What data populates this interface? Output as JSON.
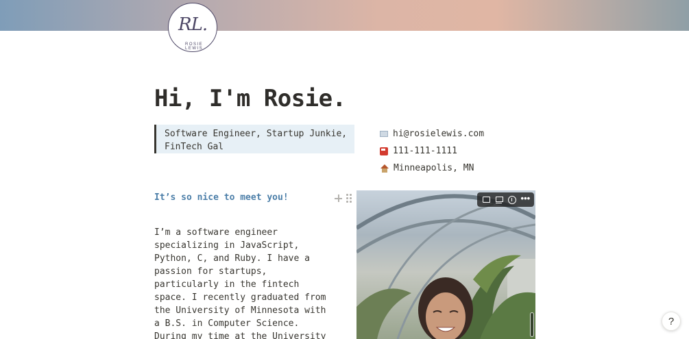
{
  "cover": {
    "gradient_colors": [
      "#7f9db8",
      "#dcb5a6",
      "#8f9fa6"
    ]
  },
  "logo": {
    "monogram": "RL.",
    "name": "ROSIE LEWIS"
  },
  "page": {
    "title": "Hi, I'm Rosie."
  },
  "quote": {
    "text": "Software Engineer, Startup Junkie, FinTech Gal"
  },
  "contact": [
    {
      "icon": "postbox-icon",
      "text": "hi@rosielewis.com"
    },
    {
      "icon": "telephone-icon",
      "text": "111-111-1111"
    },
    {
      "icon": "house-icon",
      "text": "Minneapolis, MN"
    }
  ],
  "subheading": "It’s so nice to meet you!",
  "body": "I’m a software engineer\nspecializing in JavaScript,\nPython, C, and Ruby. I have a\npassion for startups,\nparticularly in the fintech\nspace. I recently graduated from\nthe University of Minnesota with\na B.S. in Computer Science.\nDuring my time at the University",
  "image_toolbar": [
    "comment-icon",
    "caption-icon",
    "download-icon",
    "more-icon"
  ],
  "help": {
    "label": "?"
  },
  "colors": {
    "accent_blue": "#4b7ea8",
    "quote_bg": "#e7f0f6",
    "text": "#37352f"
  }
}
